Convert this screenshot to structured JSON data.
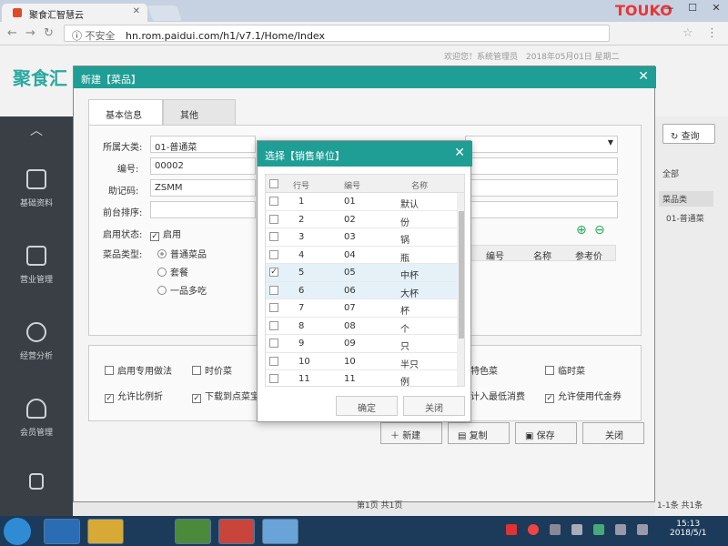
{
  "browser": {
    "tab_title": "聚食汇智慧云",
    "insecure_label": "不安全",
    "url": "hn.rom.paidui.com/h1/v7.1/Home/Index",
    "watermark": "TOUKO"
  },
  "header": {
    "logo": "聚食汇",
    "welcome": "欢迎您！系统管理员　2018年05月01日 星期二"
  },
  "sidebar": {
    "items": [
      {
        "label": "基础资料",
        "icon": "document-icon"
      },
      {
        "label": "营业管理",
        "icon": "presentation-icon"
      },
      {
        "label": "经营分析",
        "icon": "pie-chart-icon"
      },
      {
        "label": "会员管理",
        "icon": "members-icon"
      }
    ]
  },
  "right_panel": {
    "query_label": "查询",
    "all_label": "全部",
    "col_header": "菜品类",
    "cell": "01-普通菜"
  },
  "modal": {
    "title": "新建【菜品】",
    "tabs": [
      "基本信息",
      "其他"
    ],
    "fields": {
      "category_label": "所属大类:",
      "category_value": "01-普通菜",
      "code_label": "编号:",
      "code_value": "00002",
      "mnemonic_label": "助记码:",
      "mnemonic_value": "ZSMM",
      "sort_label": "前台排序:",
      "enable_label": "启用状态:",
      "enable_value": "启用",
      "type_label": "菜品类型:",
      "type_options": [
        "普通菜品",
        "套餐",
        "一品多吃"
      ]
    },
    "sub_headers": [
      "编号",
      "名称",
      "参考价"
    ],
    "options_row1": [
      "启用专用做法",
      "时价菜",
      "特色菜",
      "临时菜"
    ],
    "options_row2": [
      "允许比例折",
      "下载到点菜宝",
      "计入最低消费",
      "允许使用代金券"
    ],
    "buttons": {
      "new": "新建",
      "copy": "复制",
      "save": "保存",
      "close": "关闭"
    },
    "pager_left": "第1页 共1页",
    "pager_right": "1-1条 共1条"
  },
  "dialog": {
    "title": "选择【销售单位】",
    "columns": [
      "行号",
      "编号",
      "名称"
    ],
    "rows": [
      {
        "no": "1",
        "code": "01",
        "name": "默认",
        "checked": false
      },
      {
        "no": "2",
        "code": "02",
        "name": "份",
        "checked": false
      },
      {
        "no": "3",
        "code": "03",
        "name": "锅",
        "checked": false
      },
      {
        "no": "4",
        "code": "04",
        "name": "瓶",
        "checked": false
      },
      {
        "no": "5",
        "code": "05",
        "name": "中杯",
        "checked": true
      },
      {
        "no": "6",
        "code": "06",
        "name": "大杯",
        "checked": false
      },
      {
        "no": "7",
        "code": "07",
        "name": "杯",
        "checked": false
      },
      {
        "no": "8",
        "code": "08",
        "name": "个",
        "checked": false
      },
      {
        "no": "9",
        "code": "09",
        "name": "只",
        "checked": false
      },
      {
        "no": "10",
        "code": "10",
        "name": "半只",
        "checked": false
      },
      {
        "no": "11",
        "code": "11",
        "name": "例",
        "checked": false
      }
    ],
    "ok_label": "确定",
    "close_label": "关闭"
  },
  "taskbar": {
    "time": "15:13",
    "date": "2018/5/1"
  }
}
